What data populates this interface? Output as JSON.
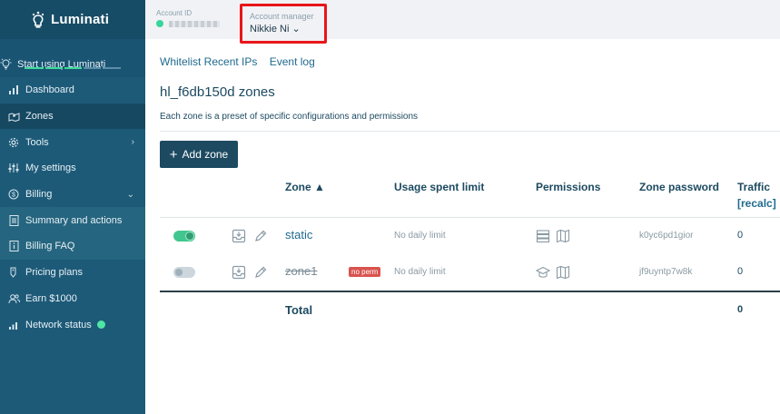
{
  "app": {
    "brand": "Luminati"
  },
  "sidebar": {
    "start_label": "Start using Luminati",
    "start_progress_percent": 60,
    "items": [
      {
        "label": "Dashboard"
      },
      {
        "label": "Zones"
      },
      {
        "label": "Tools"
      },
      {
        "label": "My settings"
      },
      {
        "label": "Billing"
      },
      {
        "label": "Summary and actions"
      },
      {
        "label": "Billing FAQ"
      },
      {
        "label": "Pricing plans"
      },
      {
        "label": "Earn $1000"
      },
      {
        "label": "Network status"
      }
    ]
  },
  "topbar": {
    "account_label": "Account ID",
    "manager_label": "Account manager",
    "manager_name": "Nikkie Ni",
    "manager_chevron": "⌄"
  },
  "main": {
    "links": [
      "Whitelist Recent IPs",
      "Event log"
    ],
    "title": "hl_f6db150d zones",
    "description": "Each zone is a preset of specific configurations and permissions",
    "add_zone_label": "Add zone",
    "table": {
      "headers": {
        "zone": "Zone",
        "zone_sort": "▲",
        "usage": "Usage spent limit",
        "permissions": "Permissions",
        "password": "Zone password",
        "traffic": "Traffic",
        "recalc": "[recalc]"
      },
      "rows": [
        {
          "enabled": true,
          "name": "static",
          "badge": "",
          "limit": "No daily limit",
          "password": "k0yc6pd1gior",
          "traffic": "0"
        },
        {
          "enabled": false,
          "name": "zone1",
          "badge": "no perm",
          "limit": "No daily limit",
          "password": "jf9uyntp7w8k",
          "traffic": "0"
        }
      ],
      "total_label": "Total",
      "total_value": "0"
    }
  },
  "colors": {
    "sidebar": "#1d5a78",
    "accent_green": "#41c68f",
    "highlight_red": "#e8161a",
    "primary_button": "#1d4a61"
  }
}
